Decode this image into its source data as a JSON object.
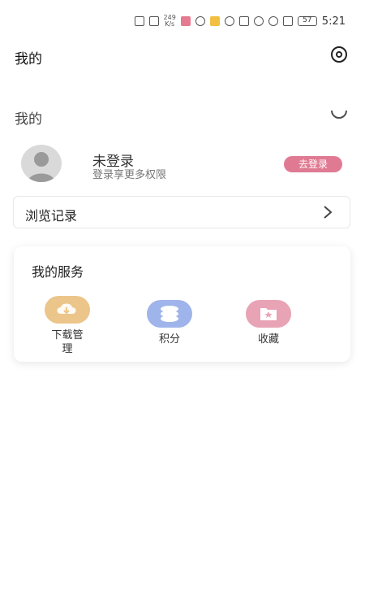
{
  "status_bar": {
    "network": "249",
    "network_unit": "K/s",
    "battery": "57",
    "time": "5:21"
  },
  "header": {
    "title": "我的",
    "title_ghost": "我的"
  },
  "profile": {
    "name": "未登录",
    "subtitle": "登录享更多权限",
    "login_button": "去登录"
  },
  "history": {
    "label": "浏览记录"
  },
  "services": {
    "title": "我的服务",
    "items": [
      {
        "label": "下载管",
        "label2": "理",
        "color": "#ebc58a"
      },
      {
        "label": "积分",
        "color": "#9fb4ea"
      },
      {
        "label": "收藏",
        "color": "#e8a3b5"
      }
    ]
  },
  "colors": {
    "accent": "#e07a92",
    "card_shadow": "#000000"
  }
}
